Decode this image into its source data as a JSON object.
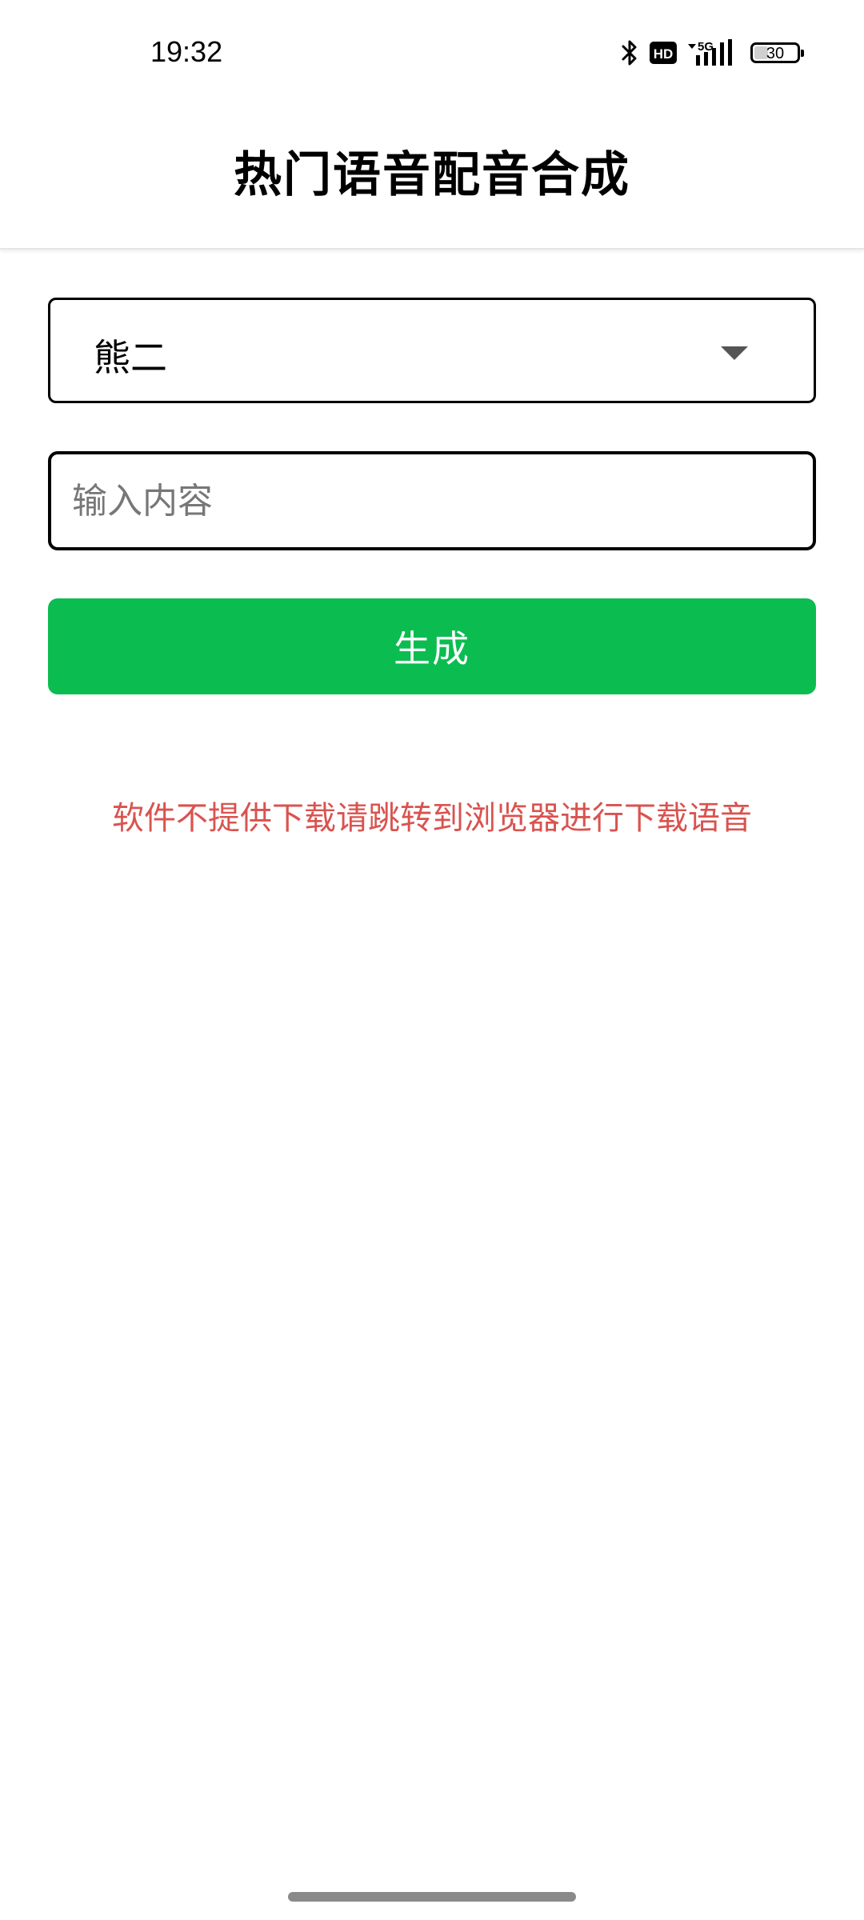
{
  "status_bar": {
    "time": "19:32",
    "network": "5G",
    "hd_label": "HD",
    "battery_level": "30",
    "battery_fraction": 0.3,
    "icons": [
      "bluetooth-icon",
      "hd-icon",
      "5g-signal-icon",
      "battery-icon"
    ]
  },
  "header": {
    "title": "热门语音配音合成"
  },
  "form": {
    "voice_select": {
      "selected": "熊二",
      "icon": "dropdown-arrow-icon"
    },
    "content_input": {
      "placeholder": "输入内容",
      "value": ""
    },
    "generate_label": "生成"
  },
  "notice": {
    "text": "软件不提供下载请跳转到浏览器进行下载语音",
    "color": "#d9534f"
  },
  "colors": {
    "primary_button": "#0bbd50",
    "notice": "#d9534f"
  }
}
